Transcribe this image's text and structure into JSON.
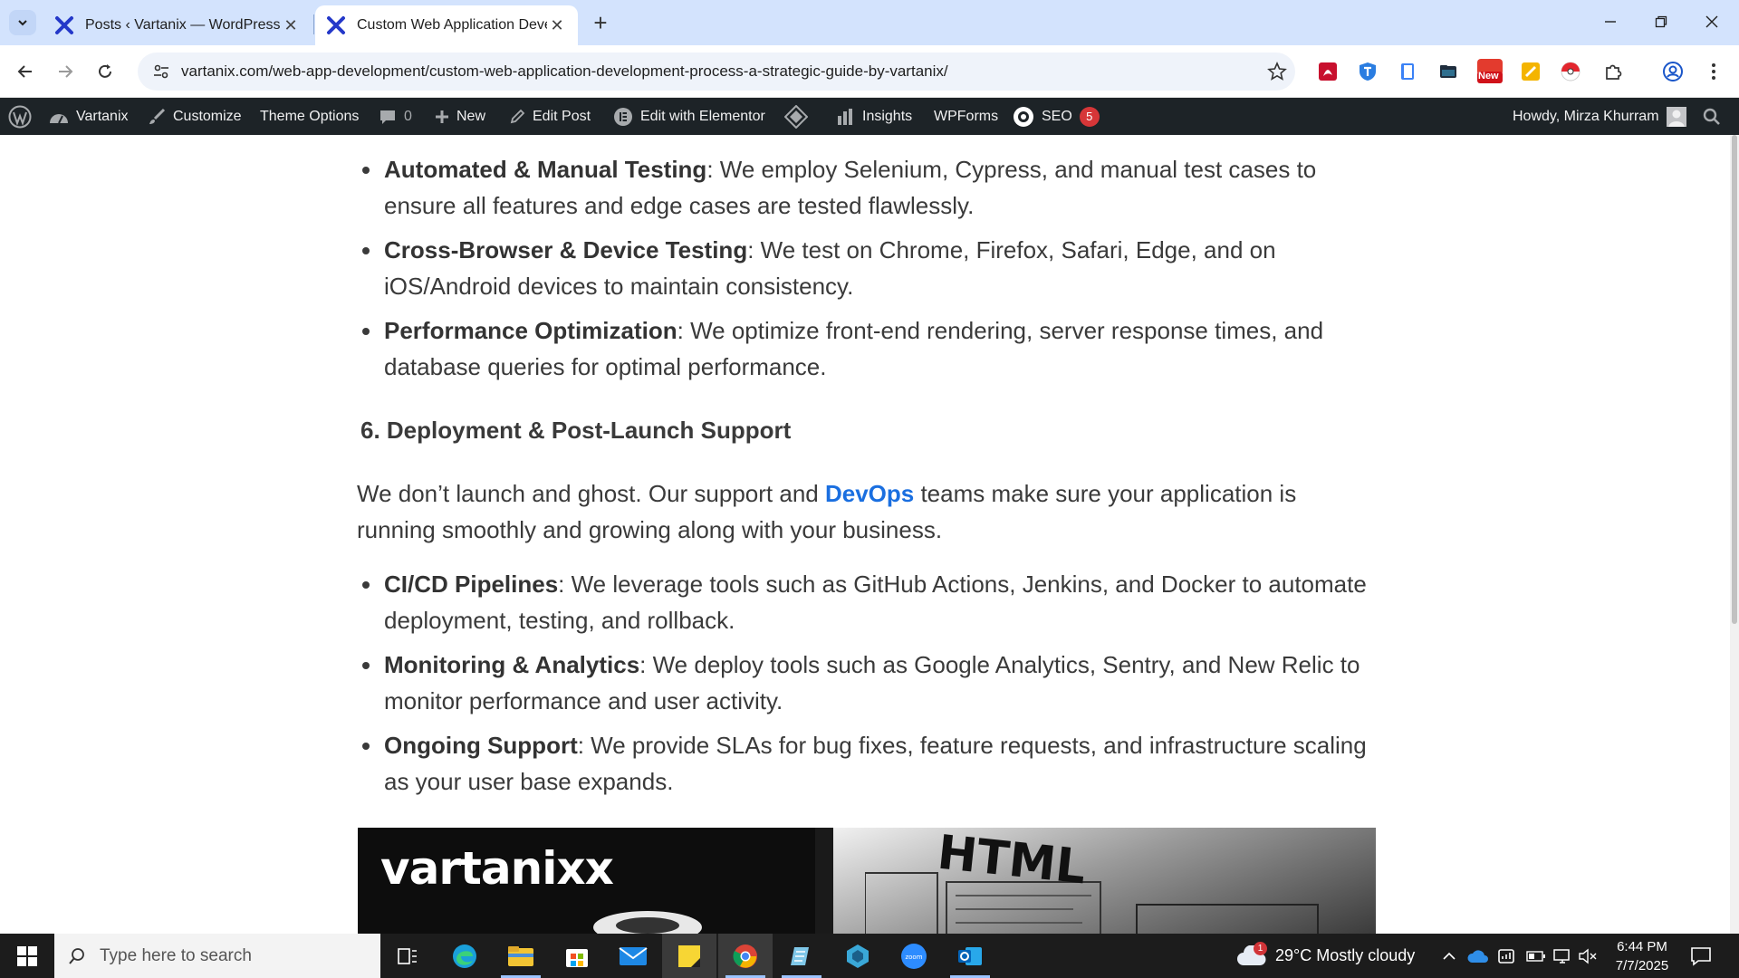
{
  "browser": {
    "tabs": [
      {
        "title": "Posts ‹ Vartanix — WordPress",
        "active": false
      },
      {
        "title": "Custom Web Application Devel",
        "active": true
      }
    ],
    "url": "vartanix.com/web-app-development/custom-web-application-development-process-a-strategic-guide-by-vartanix/",
    "extensions": [
      "pdf-icon",
      "shield-icon",
      "doc-icon",
      "folder-icon",
      "new-badge-icon",
      "notes-icon",
      "pokeball-icon",
      "puzzle-icon"
    ],
    "new_badge": "New"
  },
  "adminbar": {
    "site": "Vartanix",
    "customize": "Customize",
    "theme_options": "Theme Options",
    "comments_count": "0",
    "new": "New",
    "edit_post": "Edit Post",
    "edit_elementor": "Edit with Elementor",
    "insights": "Insights",
    "wpforms": "WPForms",
    "seo": "SEO",
    "seo_badge": "5",
    "howdy": "Howdy, Mirza Khurram"
  },
  "article": {
    "testing_list": [
      {
        "term": "Automated & Manual Testing",
        "text": ": We employ Selenium, Cypress, and manual test cases to ensure all features and edge cases are tested flawlessly."
      },
      {
        "term": "Cross-Browser & Device Testing",
        "text": ": We test on Chrome, Firefox, Safari, Edge, and on iOS/Android devices to maintain consistency."
      },
      {
        "term": "Performance Optimization",
        "text": ": We optimize front-end rendering, server response times, and database queries for optimal performance."
      }
    ],
    "heading": "6. Deployment & Post-Launch Support",
    "para_before": "We don’t launch and ghost. Our support and ",
    "para_link": "DevOps",
    "para_after": " teams make sure your application is running smoothly and growing along with your business.",
    "deploy_list": [
      {
        "term": "CI/CD Pipelines",
        "text": ": We leverage tools such as GitHub Actions, Jenkins, and Docker to automate deployment, testing, and rollback."
      },
      {
        "term": "Monitoring & Analytics",
        "text": ": We deploy tools such as Google Analytics, Sentry, and New Relic to monitor performance and user activity."
      },
      {
        "term": "Ongoing Support",
        "text": ": We provide SLAs for bug fixes, feature requests, and infrastructure scaling as your user base expands."
      }
    ],
    "hero": {
      "logo": "vartanix",
      "logo_mark": "x",
      "overlay": "HTML"
    }
  },
  "taskbar": {
    "search_placeholder": "Type here to search",
    "weather_badge": "1",
    "weather": "29°C  Mostly cloudy",
    "time": "6:44 PM",
    "date": "7/7/2025"
  },
  "colors": {
    "adminbar": "#1d2327",
    "link": "#1a6fe0",
    "tabstrip": "#d3e3fd",
    "badge": "#d63638"
  }
}
